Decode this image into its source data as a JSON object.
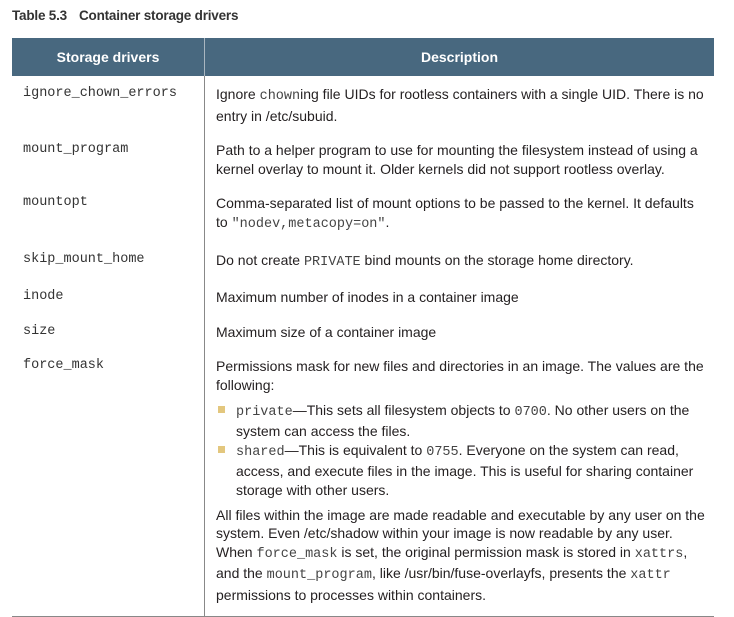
{
  "caption": {
    "number": "Table 5.3",
    "title": "Container storage drivers"
  },
  "headers": [
    "Storage drivers",
    "Description"
  ],
  "colors": {
    "header_bg": "#48687f",
    "bullet": "#e3c77e"
  },
  "rows": [
    {
      "driver": "ignore_chown_errors",
      "blocks": [
        {
          "type": "p",
          "segs": [
            {
              "t": "Ignore "
            },
            {
              "t": "chown",
              "code": true
            },
            {
              "t": "ing file UIDs for rootless containers with a single UID. There is no entry in /etc/subuid."
            }
          ]
        }
      ]
    },
    {
      "driver": "mount_program",
      "blocks": [
        {
          "type": "p",
          "segs": [
            {
              "t": "Path to a helper program to use for mounting the filesystem instead of using a kernel overlay to mount it. Older kernels did not support rootless overlay."
            }
          ]
        }
      ]
    },
    {
      "driver": "mountopt",
      "blocks": [
        {
          "type": "p",
          "segs": [
            {
              "t": "Comma-separated list of mount options to be passed to the kernel. It defaults to "
            },
            {
              "t": "\"nodev,metacopy=on\"",
              "code": true
            },
            {
              "t": "."
            }
          ]
        }
      ]
    },
    {
      "driver": "skip_mount_home",
      "blocks": [
        {
          "type": "p",
          "segs": [
            {
              "t": "Do not create "
            },
            {
              "t": "PRIVATE",
              "code": true
            },
            {
              "t": " bind mounts on the storage home directory."
            }
          ]
        }
      ]
    },
    {
      "driver": "inode",
      "blocks": [
        {
          "type": "p",
          "segs": [
            {
              "t": "Maximum number of inodes in a container image"
            }
          ]
        }
      ]
    },
    {
      "driver": "size",
      "blocks": [
        {
          "type": "p",
          "segs": [
            {
              "t": "Maximum size of a container image"
            }
          ]
        }
      ]
    },
    {
      "driver": "force_mask",
      "blocks": [
        {
          "type": "p",
          "segs": [
            {
              "t": "Permissions mask for new files and directories in an image. The values are the following:"
            }
          ]
        },
        {
          "type": "ul",
          "items": [
            {
              "segs": [
                {
                  "t": "private",
                  "code": true
                },
                {
                  "t": "—This sets all filesystem objects to "
                },
                {
                  "t": "0700",
                  "code": true
                },
                {
                  "t": ". No other users on the system can access the files."
                }
              ]
            },
            {
              "segs": [
                {
                  "t": "shared",
                  "code": true
                },
                {
                  "t": "—This is equivalent to "
                },
                {
                  "t": "0755",
                  "code": true
                },
                {
                  "t": ". Everyone on the system can read, access, and execute files in the image. This is useful for sharing container storage with other users."
                }
              ]
            }
          ]
        },
        {
          "type": "p",
          "segs": [
            {
              "t": "All files within the image are made readable and executable by any user on the system. Even /etc/shadow within your image is now readable by any user. When "
            },
            {
              "t": "force_mask",
              "code": true
            },
            {
              "t": " is set, the original permission mask is stored in "
            },
            {
              "t": "xattrs",
              "code": true
            },
            {
              "t": ", and the "
            },
            {
              "t": "mount_program",
              "code": true
            },
            {
              "t": ", like /usr/bin/fuse-overlayfs, presents the "
            },
            {
              "t": "xattr",
              "code": true
            },
            {
              "t": " permissions to processes within containers."
            }
          ]
        }
      ]
    }
  ]
}
